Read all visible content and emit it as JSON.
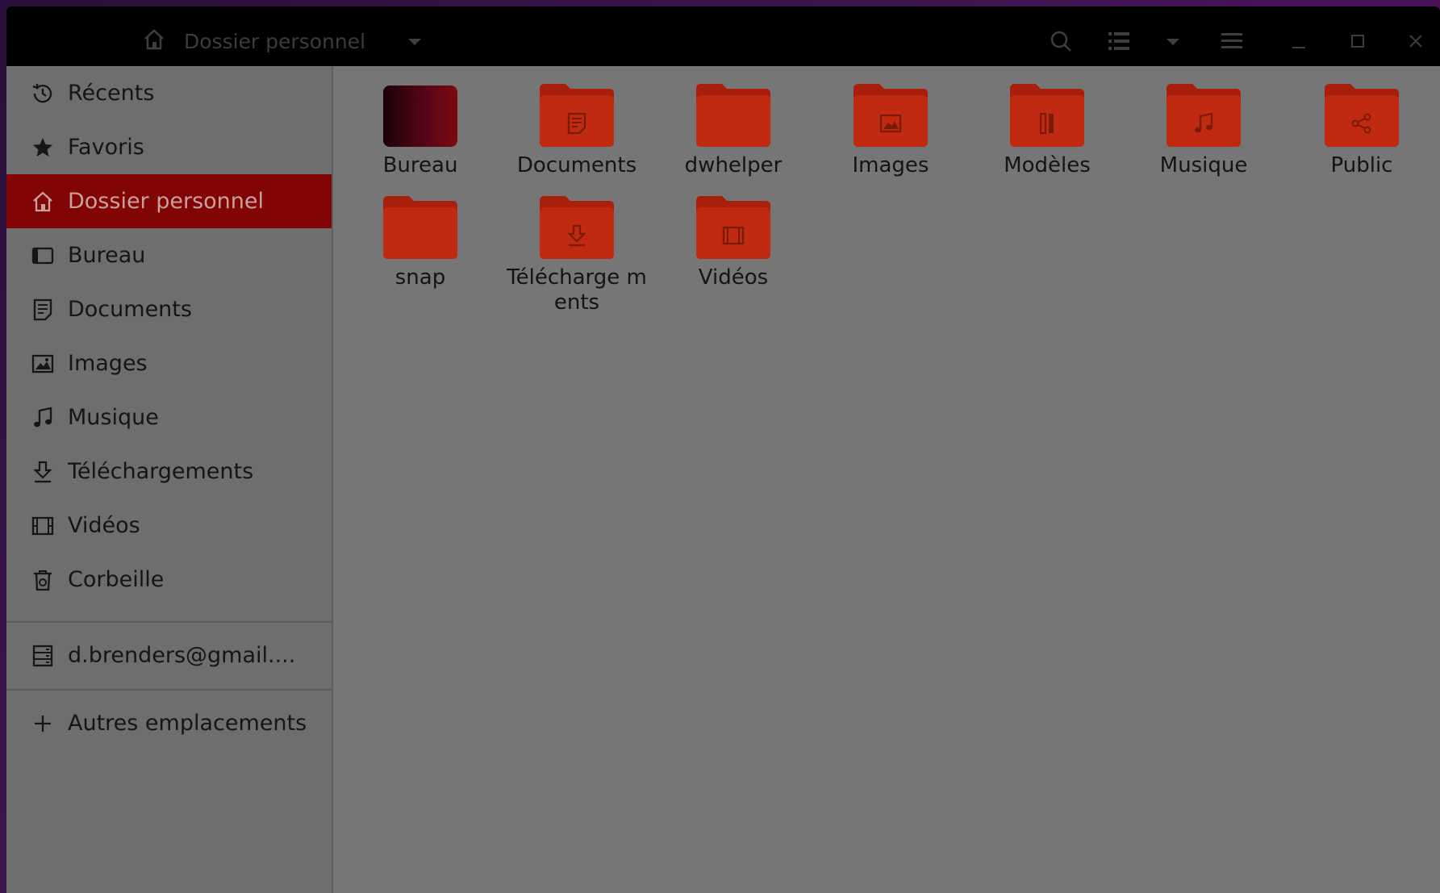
{
  "window": {
    "title": "Dossier personnel"
  },
  "sidebar": {
    "items": [
      {
        "label": "Récents",
        "icon": "clock-icon"
      },
      {
        "label": "Favoris",
        "icon": "star-icon"
      },
      {
        "label": "Dossier personnel",
        "icon": "home-icon",
        "active": true
      },
      {
        "label": "Bureau",
        "icon": "desktop-icon"
      },
      {
        "label": "Documents",
        "icon": "document-icon"
      },
      {
        "label": "Images",
        "icon": "image-icon"
      },
      {
        "label": "Musique",
        "icon": "music-icon"
      },
      {
        "label": "Téléchargements",
        "icon": "download-icon"
      },
      {
        "label": "Vidéos",
        "icon": "film-icon"
      },
      {
        "label": "Corbeille",
        "icon": "trash-icon"
      }
    ],
    "account": {
      "label": "d.brenders@gmail....",
      "icon": "server-icon"
    },
    "other_locations": {
      "label": "Autres emplacements",
      "icon": "plus-icon"
    }
  },
  "files": [
    {
      "name": "Bureau",
      "glyph": "none"
    },
    {
      "name": "Documents",
      "glyph": "document"
    },
    {
      "name": "dwhelper",
      "glyph": "none"
    },
    {
      "name": "Images",
      "glyph": "image"
    },
    {
      "name": "Modèles",
      "glyph": "template"
    },
    {
      "name": "Musique",
      "glyph": "music"
    },
    {
      "name": "Public",
      "glyph": "share"
    },
    {
      "name": "snap",
      "glyph": "none"
    },
    {
      "name": "Télécharge ments",
      "glyph": "download"
    },
    {
      "name": "Vidéos",
      "glyph": "film"
    }
  ],
  "colors": {
    "accent": "#810505",
    "folder": "#c02a10",
    "headerbar": "#000000"
  }
}
